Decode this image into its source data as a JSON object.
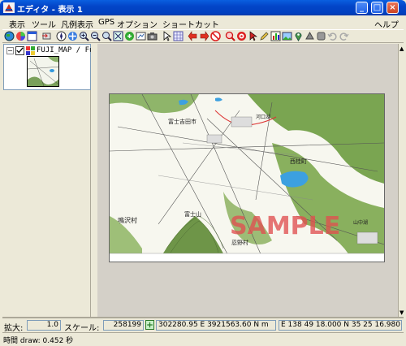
{
  "window": {
    "title": "エディタ - 表示 1",
    "minimize_icon": "minimize-icon",
    "maximize_icon": "maximize-icon",
    "close_icon": "close-icon"
  },
  "menu": {
    "items": [
      "表示",
      "ツール",
      "凡例表示",
      "GPS",
      "オプション",
      "ショートカット"
    ],
    "help": "ヘルプ"
  },
  "toolbar": {
    "icons": [
      "globe-icon",
      "color-wheel-icon",
      "window-icon",
      "layer-arrow-icon",
      "compass-icon",
      "cross-arrows-icon",
      "zoom-in-icon",
      "zoom-minus-icon",
      "zoom-out-icon",
      "zoom-extent-icon",
      "pan-icon",
      "draw-tool-icon",
      "camera-icon",
      "cursor-pointer-icon",
      "grid-icon",
      "arrow-left-icon",
      "arrow-right-icon",
      "stop-icon",
      "magnifier-red-icon",
      "target-icon",
      "select-arrow-icon",
      "edit-pen-icon",
      "chart-icon",
      "image-icon",
      "pin-icon",
      "shape-icon",
      "gray-box-icon",
      "undo-icon",
      "redo-icon"
    ]
  },
  "layers": {
    "name": "FUJI_MAP / Fuji",
    "checked": true
  },
  "map": {
    "watermark": "SAMPLE",
    "labels": [
      "富士吉田市",
      "西桂町",
      "河口湖",
      "鳴沢村",
      "富士山",
      "忍野村",
      "山中湖"
    ]
  },
  "status": {
    "zoom_label": "拡大:",
    "zoom_value": "1.0",
    "scale_label": "スケール:",
    "scale_value": "258199",
    "xy_value": "302280.95 E  3921563.60 N m",
    "latlon_value": "E 138 49 18.000  N 35 25 16.980"
  },
  "timing": {
    "text": "時間 draw: 0.452 秒"
  },
  "colors": {
    "titlebar": "#0040c0",
    "chrome": "#ece9d8",
    "viewport": "#d4d0c8",
    "watermark": "#e05050",
    "forest": "#5a8a3a"
  }
}
